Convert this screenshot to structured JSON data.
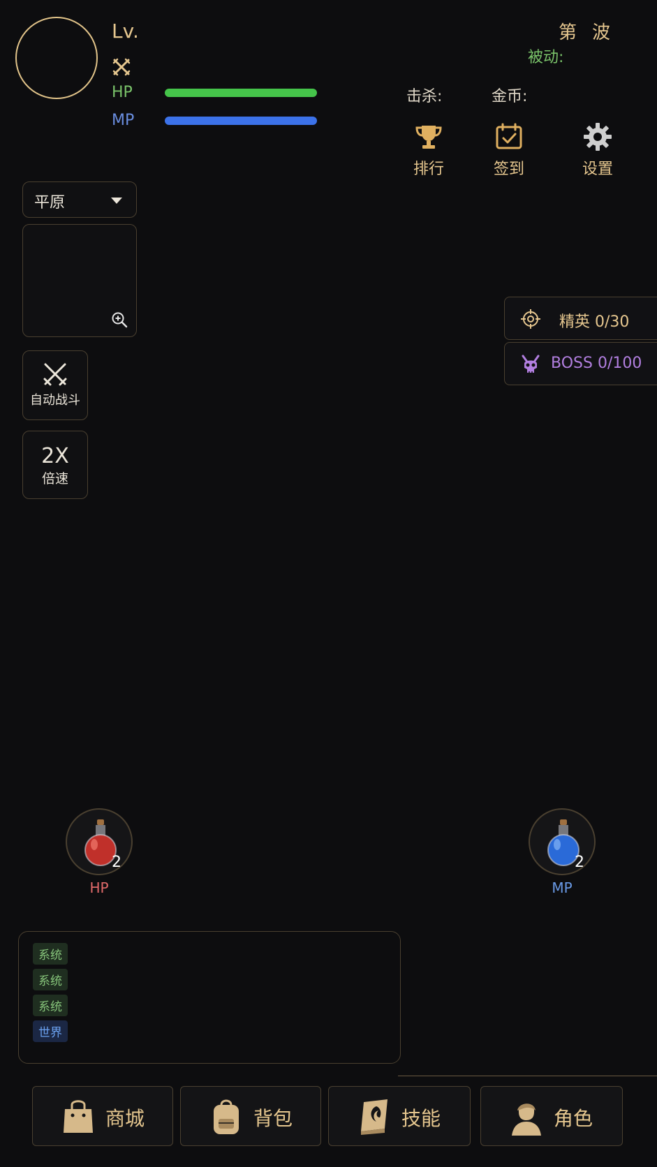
{
  "header": {
    "level_label": "Lv.",
    "hp_label": "HP",
    "mp_label": "MP",
    "hp_fill": 1.0,
    "mp_fill": 1.0,
    "wave_label": "第波",
    "passive_label": "被动:",
    "kills_label": "击杀:",
    "gold_label": "金币:"
  },
  "top_buttons": {
    "rank": "排行",
    "checkin": "签到",
    "settings": "设置"
  },
  "left_panel": {
    "map_select": "平原",
    "auto_battle": "自动战斗",
    "speed_value": "2X",
    "speed_label": "倍速"
  },
  "counters": {
    "elite": "精英 0/30",
    "boss": "BOSS 0/100"
  },
  "potions": {
    "hp_count": "2",
    "hp_label": "HP",
    "mp_count": "2",
    "mp_label": "MP"
  },
  "chat": {
    "tags": [
      "系统",
      "系统",
      "系统",
      "世界"
    ]
  },
  "nav": {
    "shop": "商城",
    "bag": "背包",
    "skills": "技能",
    "character": "角色"
  },
  "colors": {
    "accent_gold": "#e6c78f",
    "hp_green": "#45c44a",
    "mp_blue": "#3c72e9",
    "boss_purple": "#b27fe0"
  }
}
